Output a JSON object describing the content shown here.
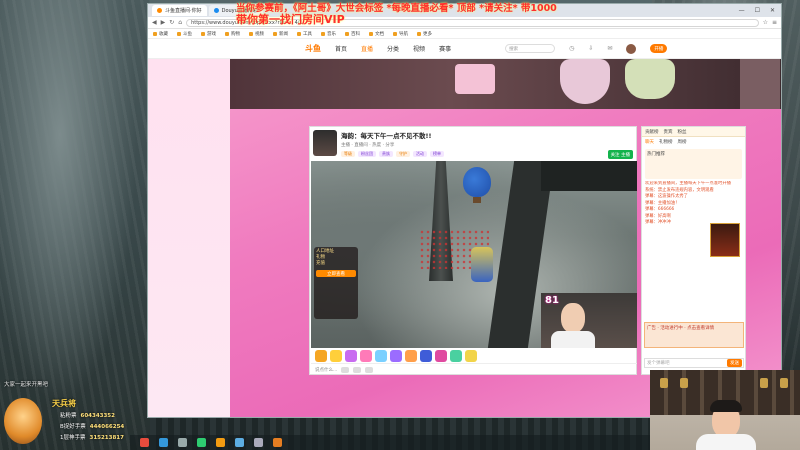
{
  "overlay": {
    "line1": "当你参赛前，《阿土哥》大世会标签 *每晚直播必看* 顶部 *请关注* 带1000",
    "line2": "带你第一找门房间VIP"
  },
  "browser": {
    "tabs": [
      "斗鱼直播间·你好",
      "Douyu直播精彩"
    ],
    "url": "https://www.douyu.com/topic/xxx?rid=... 4/1",
    "bookmarks": [
      "收藏",
      "斗鱼",
      "游戏",
      "购物",
      "视频",
      "新闻",
      "工具",
      "音乐",
      "百科",
      "文档",
      "导航",
      "更多"
    ],
    "window_controls": [
      "—",
      "☐",
      "✕"
    ]
  },
  "site": {
    "logo": "斗鱼",
    "nav": [
      "首页",
      "直播",
      "分类",
      "视频",
      "赛事"
    ],
    "active_nav": "直播",
    "search_placeholder": "搜索",
    "open_button": "开播"
  },
  "player": {
    "title": "海韵：每天下午一点不见不散!!",
    "meta": "主播 · 直播间 · 热度 · 分享",
    "tags": [
      "等级",
      "粉丝团",
      "贵族",
      "守护",
      "活动",
      "榜单"
    ],
    "subscribe_button": "关注 主播",
    "gift_panel": [
      "人口地址",
      "礼物",
      "充值"
    ],
    "gift_button": "立即查看",
    "like_count": "81",
    "input_placeholder": "说点什么..."
  },
  "chat": {
    "top_tabs": [
      "贡献榜",
      "贵宾",
      "粉丝"
    ],
    "tabs": [
      "聊天",
      "礼物榜",
      "周榜"
    ],
    "rank_title": "热门推荐",
    "messages": [
      "欢迎来到直播间，主播每天下午一点准时开播",
      "系统：禁止发布违规内容，文明观看",
      "弹幕：这波操作太秀了",
      "弹幕：主播加油！",
      "弹幕：666666",
      "弹幕：好高啊",
      "弹幕：冲冲冲"
    ],
    "box_text": "广告 · 活动进行中 · 点击查看详情",
    "input_placeholder": "发个弹幕吧",
    "send_button": "发送"
  },
  "stats": {
    "name": "天兵将",
    "items": [
      {
        "label": "粘粉票",
        "value": "604343352"
      },
      {
        "label": "B捉好手票",
        "value": "444066254"
      },
      {
        "label": "1层神手票",
        "value": "315213817"
      }
    ],
    "caption": "大家一起来开黑吧"
  },
  "colors": {
    "accent": "#ff7a00",
    "pink": "#f07bbf",
    "overlay_red": "#ff2d2d",
    "stats_gold": "#ffd54a"
  }
}
